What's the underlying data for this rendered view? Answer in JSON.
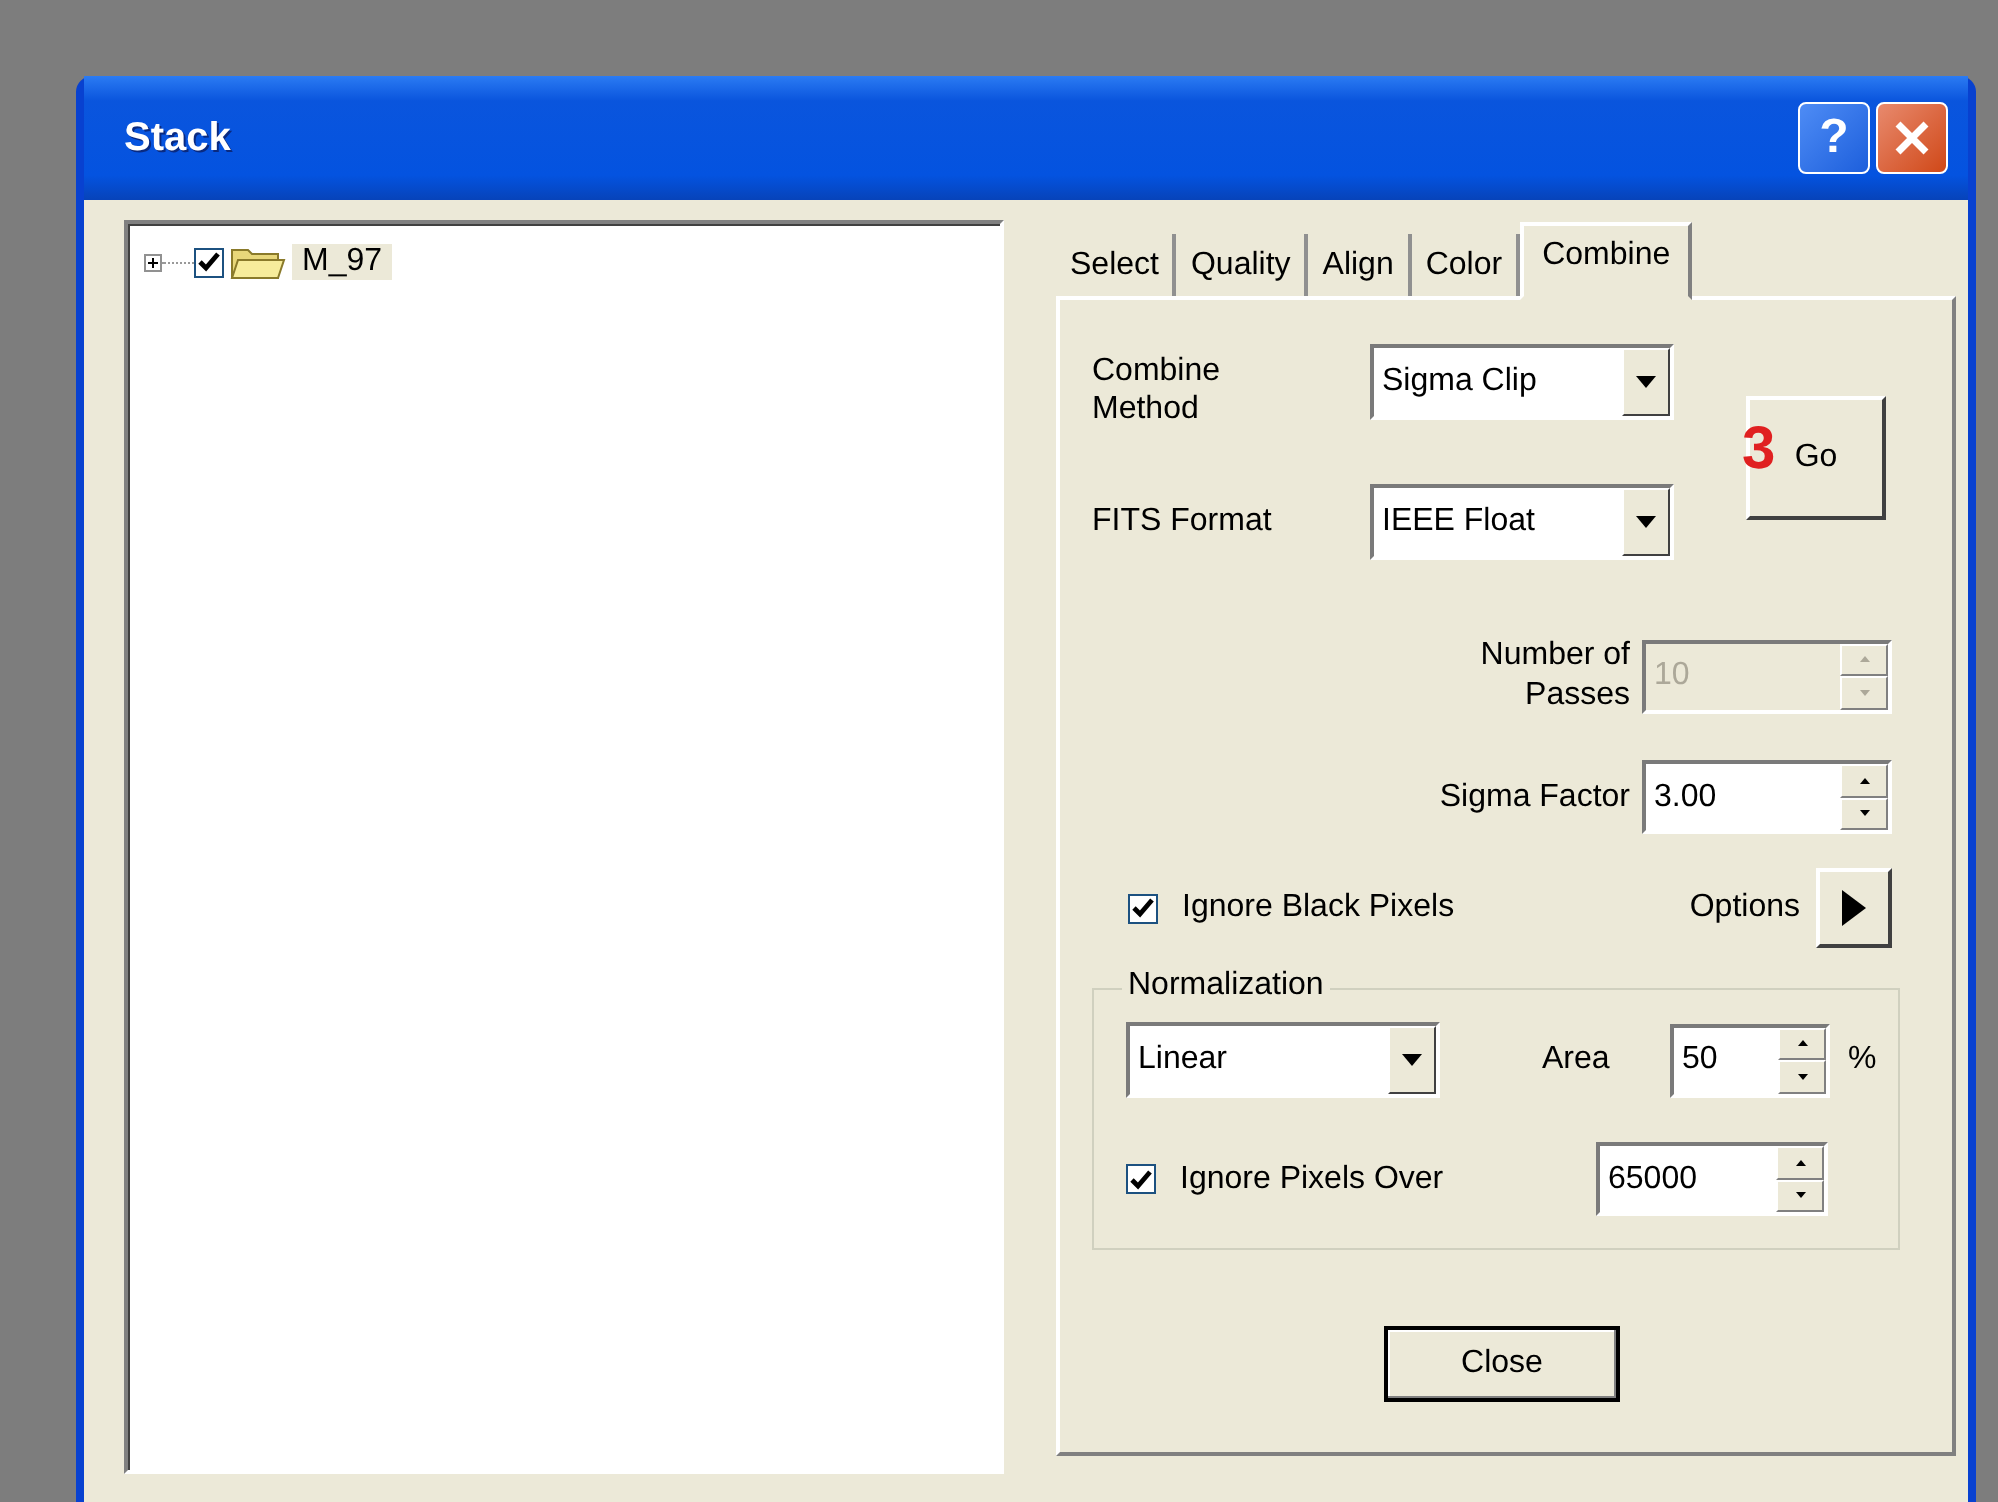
{
  "window": {
    "title": "Stack",
    "help_glyph": "?"
  },
  "tree": {
    "items": [
      {
        "label": "M_97",
        "checked": true,
        "expanded": false,
        "selected": true
      }
    ]
  },
  "tabs": [
    {
      "label": "Select",
      "selected": false
    },
    {
      "label": "Quality",
      "selected": false
    },
    {
      "label": "Align",
      "selected": false
    },
    {
      "label": "Color",
      "selected": false
    },
    {
      "label": "Combine",
      "selected": true
    }
  ],
  "combine": {
    "combine_method": {
      "label": "Combine Method",
      "value": "Sigma Clip"
    },
    "fits_format": {
      "label": "FITS Format",
      "value": "IEEE Float"
    },
    "go_button": {
      "label": "Go",
      "step_marker": "3"
    },
    "number_of_passes": {
      "label": "Number of Passes",
      "value": "10",
      "disabled": true
    },
    "sigma_factor": {
      "label": "Sigma Factor",
      "value": "3.00",
      "disabled": false
    },
    "ignore_black_pixels": {
      "label": "Ignore Black Pixels",
      "checked": true
    },
    "options": {
      "label": "Options"
    },
    "normalization": {
      "title": "Normalization",
      "method": "Linear",
      "area_label": "Area",
      "area_value": "50",
      "area_unit": "%",
      "ignore_pixels_over": {
        "label": "Ignore Pixels Over",
        "checked": true,
        "value": "65000"
      }
    },
    "close_button": "Close"
  }
}
